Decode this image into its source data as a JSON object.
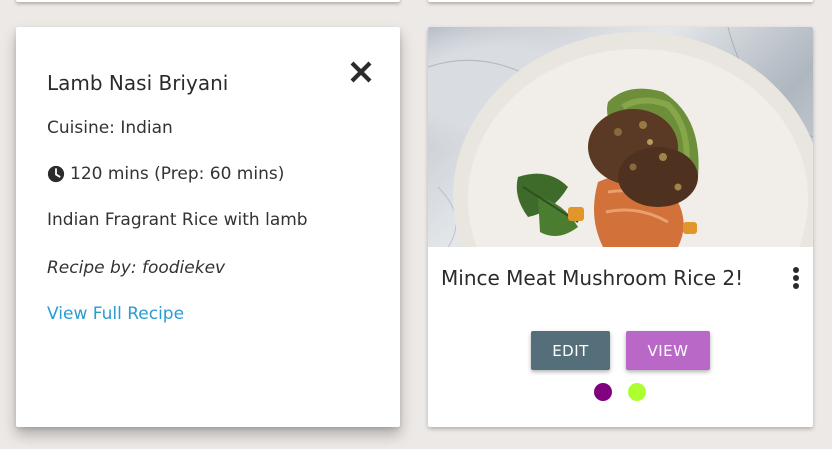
{
  "reveal_card": {
    "title": "Lamb Nasi Briyani",
    "cuisine": "Cuisine: Indian",
    "time": "120 mins (Prep: 60 mins)",
    "description": "Indian Fragrant Rice with lamb",
    "author": "Recipe by: foodiekev",
    "link_label": "View Full Recipe",
    "close_icon": "close-icon",
    "clock_icon": "clock-icon"
  },
  "recipe_card": {
    "title": "Mince Meat Mushroom Rice 2!",
    "more_icon": "more-vert-icon",
    "edit_label": "EDIT",
    "view_label": "VIEW",
    "tag_colors": [
      "#800080",
      "#adff2f"
    ]
  },
  "colors": {
    "background": "#ede9e6",
    "link": "#2b9bd2",
    "edit_button": "#546e7a",
    "view_button": "#ba68c8",
    "text_dark": "#2b2b2b"
  }
}
